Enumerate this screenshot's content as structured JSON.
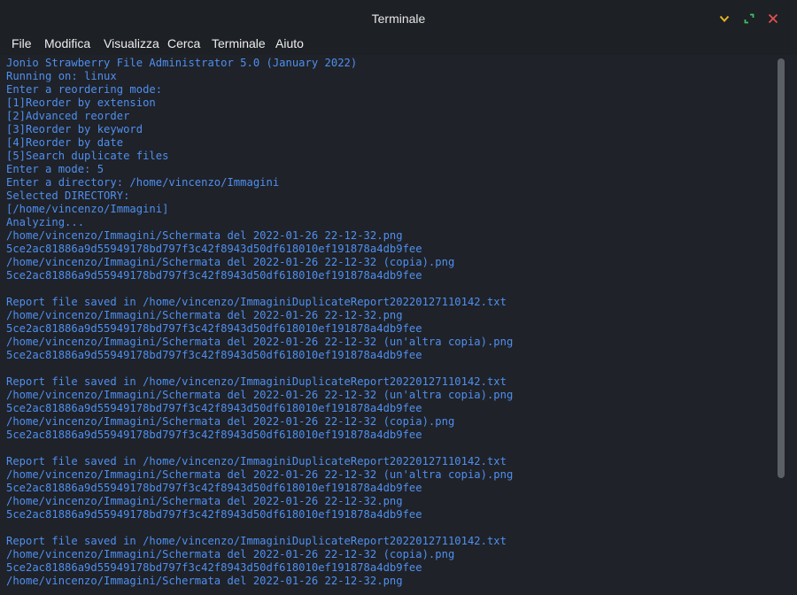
{
  "window": {
    "title": "Terminale"
  },
  "menu": [
    "File",
    "Modifica",
    "Visualizza",
    "Cerca",
    "Terminale",
    "Aiuto"
  ],
  "colors": {
    "text": "#4f8ff0",
    "background": "#1f2228",
    "minimize": "#e6b422",
    "maximize": "#3fbf5f",
    "close": "#e0504f"
  },
  "terminal_lines": [
    "Jonio Strawberry File Administrator 5.0 (January 2022)",
    "Running on: linux",
    "Enter a reordering mode:",
    "[1]Reorder by extension",
    "[2]Advanced reorder",
    "[3]Reorder by keyword",
    "[4]Reorder by date",
    "[5]Search duplicate files",
    "Enter a mode: 5",
    "Enter a directory: /home/vincenzo/Immagini",
    "Selected DIRECTORY:",
    "[/home/vincenzo/Immagini]",
    "Analyzing...",
    "/home/vincenzo/Immagini/Schermata del 2022-01-26 22-12-32.png",
    "5ce2ac81886a9d55949178bd797f3c42f8943d50df618010ef191878a4db9fee",
    "/home/vincenzo/Immagini/Schermata del 2022-01-26 22-12-32 (copia).png",
    "5ce2ac81886a9d55949178bd797f3c42f8943d50df618010ef191878a4db9fee",
    "",
    "Report file saved in /home/vincenzo/ImmaginiDuplicateReport20220127110142.txt",
    "/home/vincenzo/Immagini/Schermata del 2022-01-26 22-12-32.png",
    "5ce2ac81886a9d55949178bd797f3c42f8943d50df618010ef191878a4db9fee",
    "/home/vincenzo/Immagini/Schermata del 2022-01-26 22-12-32 (un'altra copia).png",
    "5ce2ac81886a9d55949178bd797f3c42f8943d50df618010ef191878a4db9fee",
    "",
    "Report file saved in /home/vincenzo/ImmaginiDuplicateReport20220127110142.txt",
    "/home/vincenzo/Immagini/Schermata del 2022-01-26 22-12-32 (un'altra copia).png",
    "5ce2ac81886a9d55949178bd797f3c42f8943d50df618010ef191878a4db9fee",
    "/home/vincenzo/Immagini/Schermata del 2022-01-26 22-12-32 (copia).png",
    "5ce2ac81886a9d55949178bd797f3c42f8943d50df618010ef191878a4db9fee",
    "",
    "Report file saved in /home/vincenzo/ImmaginiDuplicateReport20220127110142.txt",
    "/home/vincenzo/Immagini/Schermata del 2022-01-26 22-12-32 (un'altra copia).png",
    "5ce2ac81886a9d55949178bd797f3c42f8943d50df618010ef191878a4db9fee",
    "/home/vincenzo/Immagini/Schermata del 2022-01-26 22-12-32.png",
    "5ce2ac81886a9d55949178bd797f3c42f8943d50df618010ef191878a4db9fee",
    "",
    "Report file saved in /home/vincenzo/ImmaginiDuplicateReport20220127110142.txt",
    "/home/vincenzo/Immagini/Schermata del 2022-01-26 22-12-32 (copia).png",
    "5ce2ac81886a9d55949178bd797f3c42f8943d50df618010ef191878a4db9fee",
    "/home/vincenzo/Immagini/Schermata del 2022-01-26 22-12-32.png"
  ]
}
